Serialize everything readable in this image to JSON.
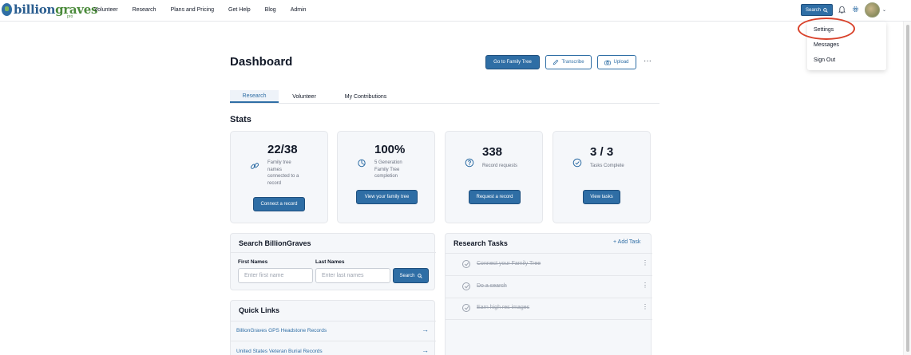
{
  "header": {
    "logo_text_a": "billion",
    "logo_text_b": "graves",
    "logo_badge": "pro",
    "nav": [
      "Volunteer",
      "Research",
      "Plans and Pricing",
      "Get Help",
      "Blog",
      "Admin"
    ],
    "search_label": "Search"
  },
  "user_menu": {
    "items": [
      "Settings",
      "Messages",
      "Sign Out"
    ]
  },
  "dashboard": {
    "title": "Dashboard",
    "go_family_tree": "Go to Family Tree",
    "transcribe": "Transcribe",
    "upload": "Upload",
    "more": "···"
  },
  "tabs": [
    "Research",
    "Volunteer",
    "My Contributions"
  ],
  "stats": {
    "title": "Stats",
    "cards": [
      {
        "value": "22/38",
        "desc_lines": [
          "Family tree",
          "names",
          "connected to a",
          "record"
        ],
        "button": "Connect a record",
        "icon": "link-icon"
      },
      {
        "value": "100%",
        "desc_lines": [
          "5 Generation",
          "Family Tree",
          "completion"
        ],
        "button": "View your family tree",
        "icon": "pie-chart-icon"
      },
      {
        "value": "338",
        "desc_lines": [
          "Record requests"
        ],
        "button": "Request a record",
        "icon": "question-circle-icon"
      },
      {
        "value": "3 / 3",
        "desc_lines": [
          "Tasks Complete"
        ],
        "button": "View tasks",
        "icon": "check-circle-icon"
      }
    ]
  },
  "search_panel": {
    "title": "Search BillionGraves",
    "first_label": "First Names",
    "first_placeholder": "Enter first name",
    "last_label": "Last Names",
    "last_placeholder": "Enter last names",
    "button": "Search"
  },
  "quick_links": {
    "title": "Quick Links",
    "links": [
      "BillionGraves GPS Headstone Records",
      "United States Veteran Burial Records"
    ]
  },
  "research_tasks": {
    "title": "Research Tasks",
    "add_label": "+ Add Task",
    "tasks": [
      "Connect your Family Tree",
      "Do a search",
      "Earn high res images"
    ]
  },
  "colors": {
    "primary": "#2f6ea5",
    "highlight_ring": "#d9422b"
  }
}
